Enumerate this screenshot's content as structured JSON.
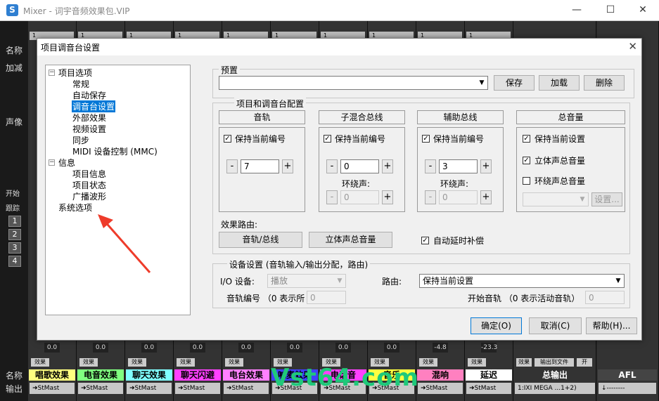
{
  "window": {
    "title": "Mixer - 词宇音频效果包.VIP",
    "min": "—",
    "max": "☐",
    "close": "✕"
  },
  "mixer": {
    "left_labels": {
      "name": "名称",
      "add": "加减",
      "pan": "声像",
      "start": "开始",
      "track": "跟踪",
      "name_bottom": "名称",
      "output": "输出"
    },
    "numbers": [
      "1",
      "2",
      "3",
      "4"
    ],
    "strips": [
      {
        "name": "唱歌效果",
        "color": "#ffff80",
        "val": "0.0",
        "fx": "效果",
        "out": "StMast"
      },
      {
        "name": "电音效果",
        "color": "#80ff80",
        "val": "0.0",
        "fx": "效果",
        "out": "StMast"
      },
      {
        "name": "聊天效果",
        "color": "#80ffff",
        "val": "0.0",
        "fx": "效果",
        "out": "StMast"
      },
      {
        "name": "聊天闪避",
        "color": "#ff40ff",
        "val": "0.0",
        "fx": "效果",
        "out": "StMast"
      },
      {
        "name": "电台效果",
        "color": "#ff80ff",
        "val": "0.0",
        "fx": "效果",
        "out": "StMast"
      },
      {
        "name": "喊麦效果",
        "color": "#4040ff",
        "val": "0.0",
        "fx": "效果",
        "out": "StMast"
      },
      {
        "name": "电话音",
        "color": "#ff40ff",
        "val": "0.0",
        "fx": "效果",
        "out": "StMast"
      },
      {
        "name": "音乐",
        "color": "#ffff40",
        "val": "0.0",
        "fx": "效果",
        "out": "StMast"
      },
      {
        "name": "混响",
        "color": "#ff80c0",
        "val": "-4.8",
        "fx": "效果",
        "out": "StMast"
      },
      {
        "name": "延迟",
        "color": "#ffffff",
        "val": "-23.3",
        "fx": "效果",
        "out": "StMast"
      }
    ],
    "master": {
      "name": "总输出",
      "out": "1:IXI MEGA ...1+2)",
      "fx": "效果",
      "file": "输出到文件",
      "open": "开"
    },
    "afl": "AFL",
    "settings_btn": "设置"
  },
  "dialog": {
    "title": "项目调音台设置",
    "close": "✕",
    "tree": {
      "project": "项目选项",
      "items": [
        "常规",
        "自动保存",
        "调音台设置",
        "外部效果",
        "视频设置",
        "同步",
        "MIDI 设备控制 (MMC)"
      ],
      "info": "信息",
      "info_items": [
        "项目信息",
        "项目状态",
        "广播波形"
      ],
      "system": "系统选项"
    },
    "preset": {
      "label": "预置",
      "value": "",
      "save": "保存",
      "load": "加载",
      "delete": "删除"
    },
    "config": {
      "label": "项目和调音台配置",
      "track": {
        "header": "音轨",
        "keep": "保持当前编号",
        "value": "7"
      },
      "submix": {
        "header": "子混合总线",
        "keep": "保持当前编号",
        "value": "0",
        "surround": "环绕声:",
        "surround_val": "0"
      },
      "aux": {
        "header": "辅助总线",
        "keep": "保持当前编号",
        "value": "3",
        "surround": "环绕声:",
        "surround_val": "0"
      },
      "master": {
        "header": "总音量",
        "keep": "保持当前设置",
        "stereo": "立体声总音量",
        "surround": "环绕声总音量",
        "setup": "设置..."
      },
      "routing_label": "效果路由:",
      "route_track": "音轨/总线",
      "route_stereo": "立体声总音量",
      "auto_delay": "自动延时补偿"
    },
    "device": {
      "label": "设备设置 (音轨输入/输出分配，路由)",
      "io_label": "I/O 设备:",
      "io_value": "播放",
      "route_label": "路由:",
      "route_value": "保持当前设置",
      "track_no_label": "音轨编号 （0 表示所",
      "track_no_value": "0",
      "start_track_label": "开始音轨 （0 表示活动音轨）",
      "start_track_value": "0"
    },
    "ok": "确定(O)",
    "cancel": "取消(C)",
    "help": "帮助(H)..."
  },
  "watermark": "Vst64.com"
}
